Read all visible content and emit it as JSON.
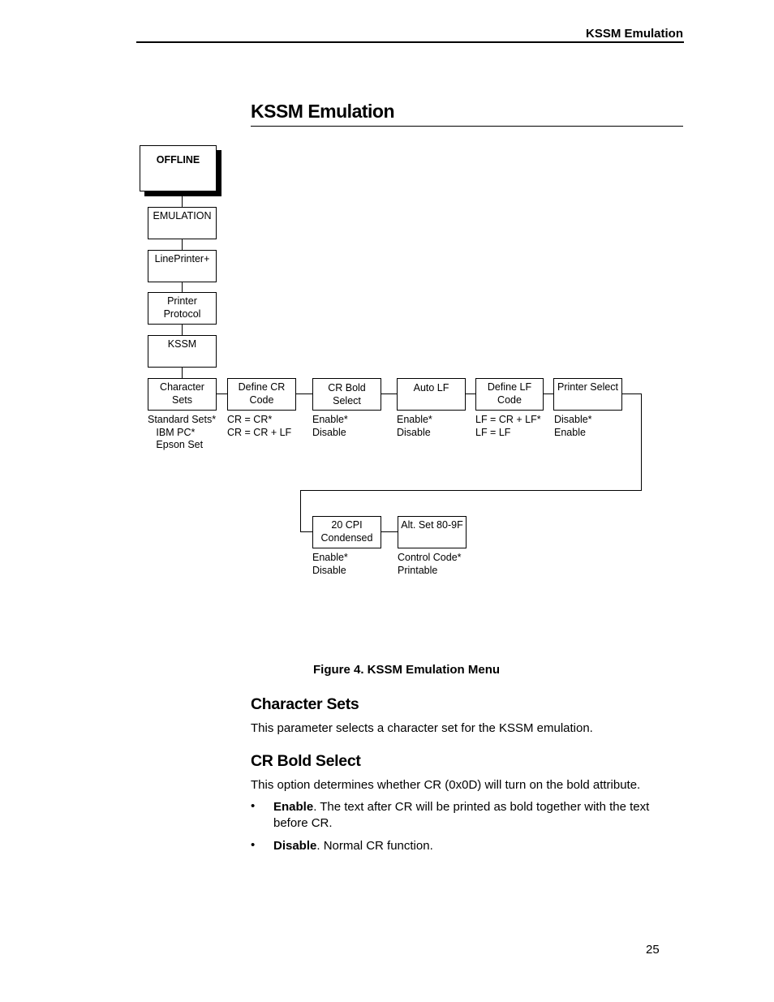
{
  "header": {
    "running_title": "KSSM Emulation"
  },
  "page": {
    "title": "KSSM Emulation",
    "number": "25"
  },
  "diagram": {
    "menu_path": [
      {
        "label": "OFFLINE"
      },
      {
        "label": "EMULATION"
      },
      {
        "label": "LinePrinter+"
      },
      {
        "label": "Printer\nProtocol"
      },
      {
        "label": "KSSM"
      }
    ],
    "row1": [
      {
        "label": "Character\nSets",
        "options": "Standard Sets*\n   IBM PC*\n   Epson Set"
      },
      {
        "label": "Define CR\nCode",
        "options": "CR = CR*\nCR = CR + LF"
      },
      {
        "label": "CR Bold\nSelect",
        "options": "Enable*\nDisable"
      },
      {
        "label": "Auto LF",
        "options": "Enable*\nDisable"
      },
      {
        "label": "Define LF\nCode",
        "options": "LF = CR + LF*\nLF = LF"
      },
      {
        "label": "Printer Select",
        "options": "Disable*\nEnable"
      }
    ],
    "row2": [
      {
        "label": "20 CPI\nCondensed",
        "options": "Enable*\nDisable"
      },
      {
        "label": "Alt. Set 80-9F",
        "options": "Control Code*\nPrintable"
      }
    ],
    "caption": "Figure 4. KSSM Emulation Menu"
  },
  "sections": [
    {
      "heading": "Character Sets",
      "body": "This parameter selects a character set for the KSSM emulation."
    },
    {
      "heading": "CR Bold Select",
      "body": "This option determines whether CR (0x0D) will turn on the bold attribute.",
      "bullets": [
        {
          "term": "Enable",
          "text": ". The text after CR will be printed as bold together with the text before CR."
        },
        {
          "term": "Disable",
          "text": ". Normal CR function."
        }
      ],
      "bullet_glyph": "•"
    }
  ]
}
